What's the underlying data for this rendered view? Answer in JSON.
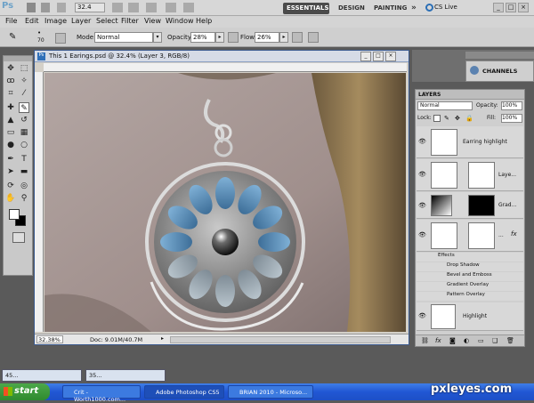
{
  "app": {
    "logo": "Ps",
    "zoom_value": "32.4",
    "workspaces": [
      "ESSENTIALS",
      "DESIGN",
      "PAINTING"
    ],
    "more": "»",
    "cs_live": "CS Live"
  },
  "menus": [
    "File",
    "Edit",
    "Image",
    "Layer",
    "Select",
    "Filter",
    "View",
    "Window",
    "Help"
  ],
  "options": {
    "brush_size": "70",
    "mode_label": "Mode:",
    "mode_value": "Normal",
    "opacity_label": "Opacity:",
    "opacity_value": "28%",
    "flow_label": "Flow:",
    "flow_value": "26%"
  },
  "document": {
    "title": "This 1 Earings.psd @ 32.4% (Layer 3, RGB/8)",
    "zoom": "32.38%",
    "doc_info": "Doc: 9.01M/40.7M"
  },
  "panels": {
    "channels_label": "CHANNELS",
    "layers_label": "LAYERS",
    "blend_mode": "Normal",
    "opacity_label": "Opacity:",
    "opacity_value": "100%",
    "lock_label": "Lock:",
    "fill_label": "Fill:",
    "fill_value": "100%",
    "layers": [
      {
        "name": "Earring highlight"
      },
      {
        "name": "Laye..."
      },
      {
        "name": "Grad..."
      },
      {
        "name": "..."
      }
    ],
    "effects_label": "Effects",
    "effects": [
      "Drop Shadow",
      "Bevel and Emboss",
      "Gradient Overlay",
      "Pattern Overlay"
    ],
    "bottom_layer": "Highlight"
  },
  "minimized": [
    "45...",
    "35..."
  ],
  "taskbar": {
    "start": "start",
    "tasks": [
      "Crit - Worth1000.com...",
      "Adobe Photoshop CS5",
      "BRIAN 2010 - Microso..."
    ],
    "watermark": "pxleyes.com"
  }
}
